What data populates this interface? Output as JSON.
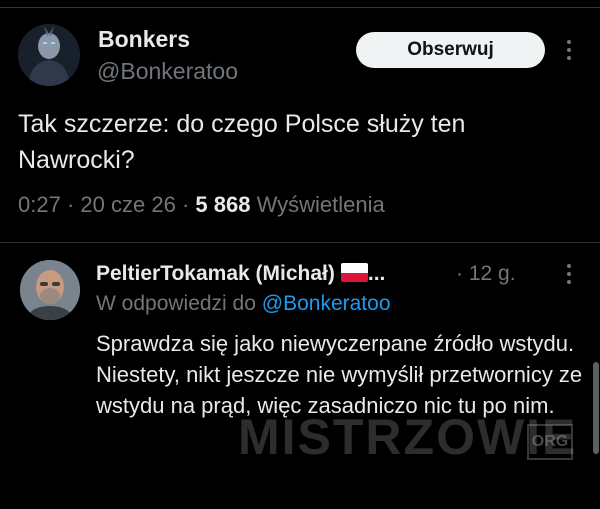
{
  "post": {
    "author": {
      "name": "Bonkers",
      "handle": "@Bonkeratoo"
    },
    "follow_label": "Obserwuj",
    "text": "Tak szczerze: do czego Polsce służy ten Nawrocki?",
    "time": "0:27",
    "date": "20 cze 26",
    "views_count": "5 868",
    "views_label": "Wyświetlenia",
    "separator": "·"
  },
  "reply": {
    "author_name": "PeltierTokamak (Michał)",
    "truncation": "...",
    "age": "· 12 g.",
    "reply_to_label": "W odpowiedzi do",
    "reply_to_handle": "@Bonkeratoo",
    "text_lines": [
      "Sprawdza się jako niewyczerpane źródło wstydu.",
      "Niestety, nikt jeszcze nie wymyślił przetwornicy ze wstydu na prąd, więc zasadniczo nic tu po nim."
    ],
    "flag_icon": "poland-flag-icon"
  },
  "watermark": {
    "text": "MISTRZOWIE",
    "box_text": "ORG"
  },
  "colors": {
    "background": "#000000",
    "text": "#e7e9ea",
    "muted": "#71767b",
    "link": "#1d9bf0",
    "follow_bg": "#eff3f4",
    "divider": "#2f3336"
  }
}
